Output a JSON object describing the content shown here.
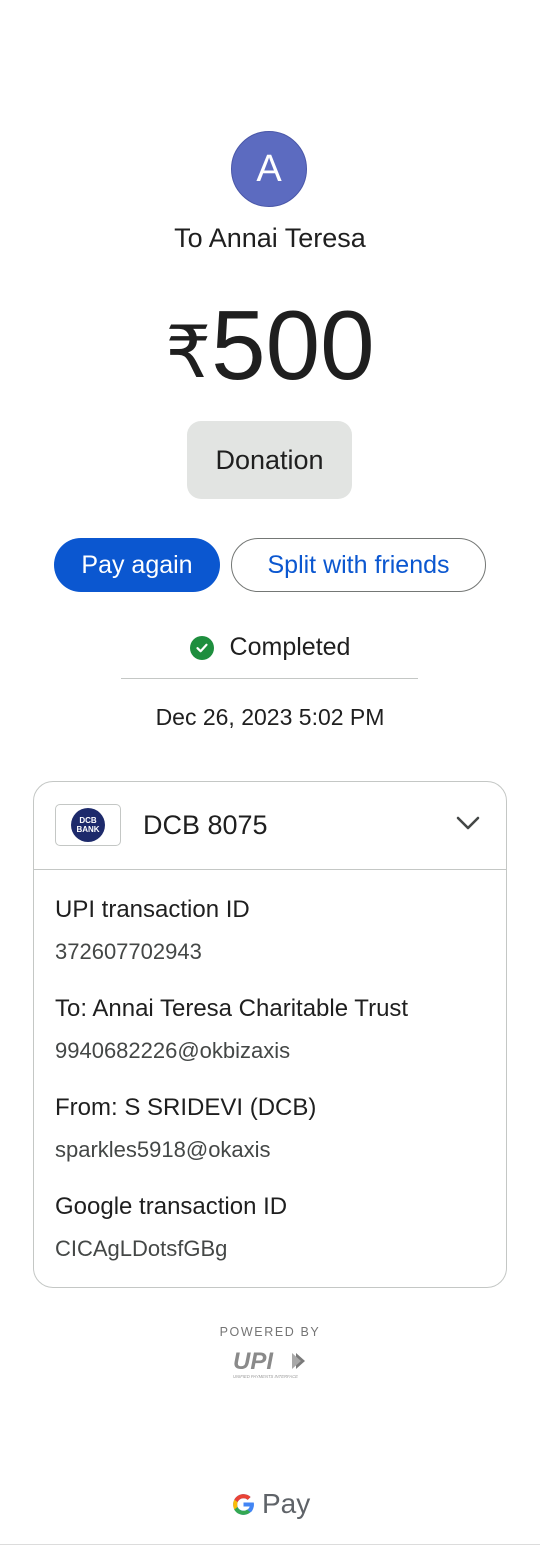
{
  "avatar": {
    "initial": "A",
    "color": "#5c6bc0"
  },
  "recipient": "To Annai Teresa",
  "amount": {
    "currency": "₹",
    "value": "500"
  },
  "note": "Donation",
  "actions": {
    "pay_again": "Pay again",
    "split": "Split with friends"
  },
  "status": {
    "label": "Completed",
    "icon": "check-circle-icon",
    "color": "#1e8e3e"
  },
  "datetime": "Dec 26, 2023 5:02 PM",
  "account": {
    "bank_logo_text": [
      "DCB",
      "BANK"
    ],
    "name": "DCB 8075",
    "expand_icon": "chevron-down-icon"
  },
  "details": [
    {
      "label": "UPI transaction ID",
      "value": "372607702943"
    },
    {
      "label": "To: Annai Teresa Charitable Trust",
      "value": "9940682226@okbizaxis"
    },
    {
      "label": "From: S SRIDEVI (DCB)",
      "value": "sparkles5918@okaxis"
    },
    {
      "label": "Google transaction ID",
      "value": "CICAgLDotsfGBg"
    }
  ],
  "footer": {
    "powered_by": "POWERED BY",
    "upi_logo": "UPI",
    "upi_tagline": "UNIFIED PAYMENTS INTERFACE",
    "brand_g": "G",
    "brand_pay": "Pay"
  },
  "colors": {
    "primary": "#0b57d0",
    "chip_bg": "#e2e4e2",
    "bank_blue": "#1d2a6b"
  }
}
